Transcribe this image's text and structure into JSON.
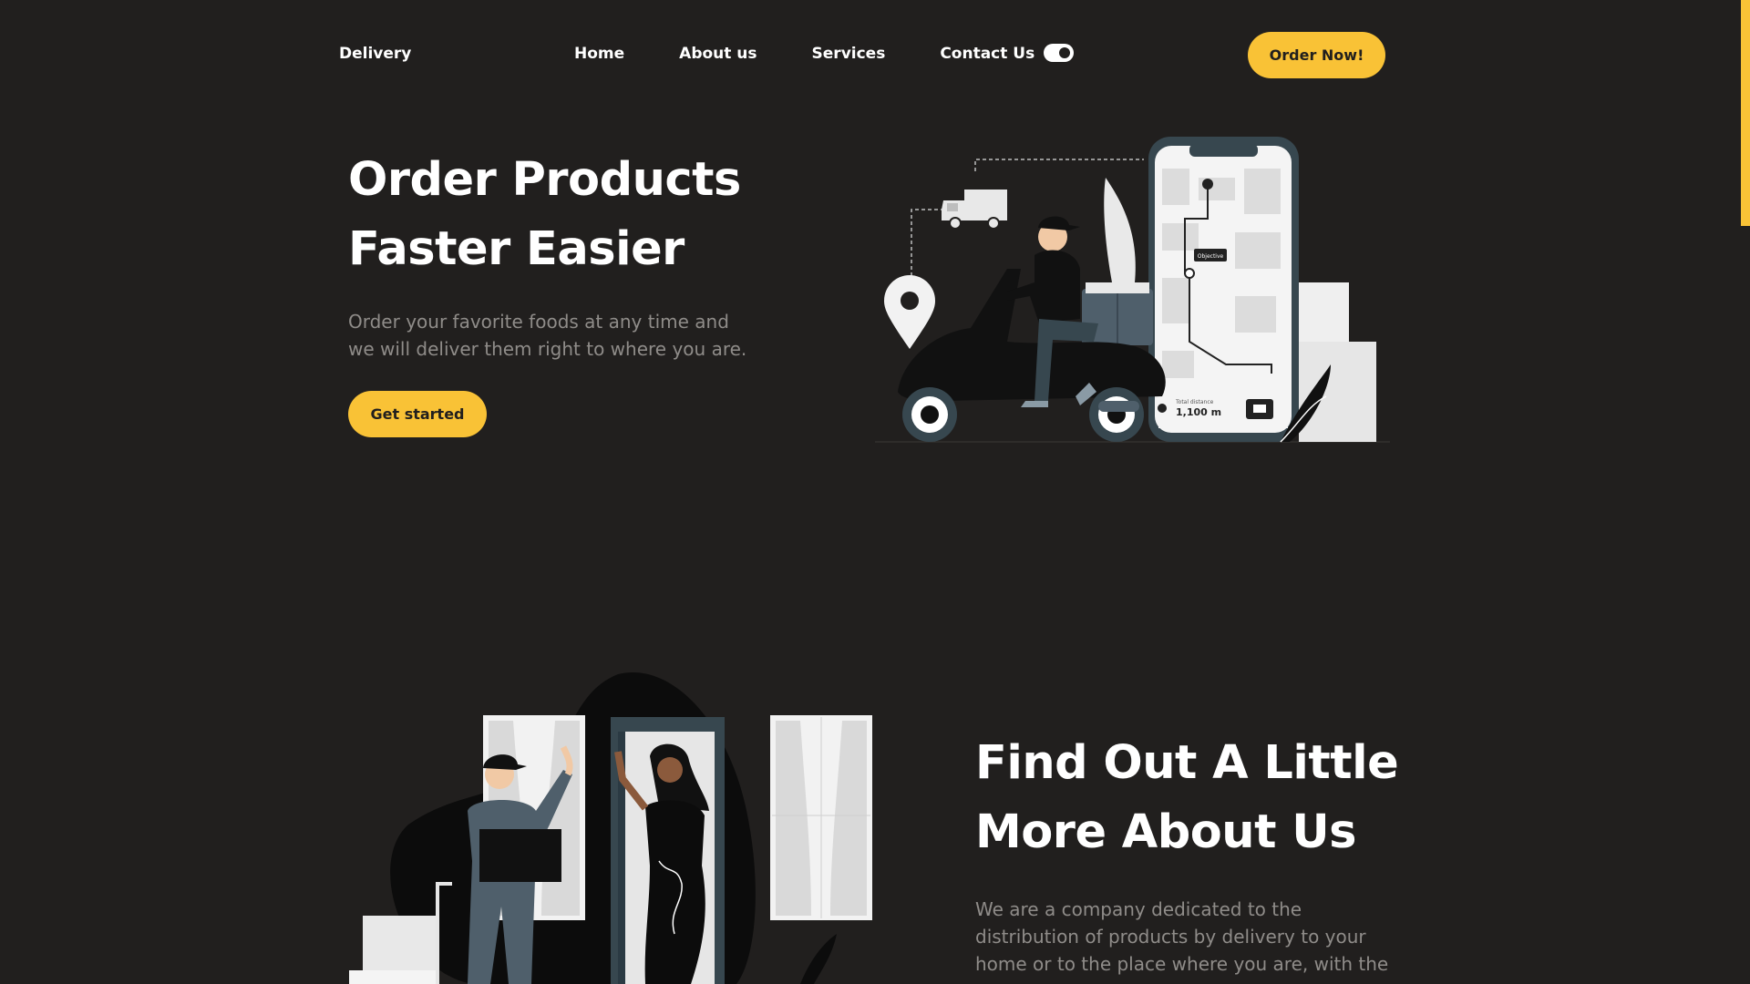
{
  "header": {
    "logo": "Delivery",
    "nav": [
      "Home",
      "About us",
      "Services",
      "Contact Us"
    ],
    "theme_toggle_state": "dark",
    "order_button": "Order Now!"
  },
  "hero": {
    "title_line1": "Order Products",
    "title_line2": "Faster Easier",
    "description": "Order your favorite foods at any time and we will deliver them right to where you are.",
    "cta_label": "Get started",
    "illustration": {
      "map_label": "Objective",
      "distance_caption": "Total distance",
      "distance_value": "1,100 m"
    }
  },
  "about": {
    "title_line1": "Find Out A Little",
    "title_line2": "More About Us",
    "description": "We are a company dedicated to the distribution of products by delivery to your home or to the place where you are, with the"
  },
  "colors": {
    "background": "#211f1e",
    "accent": "#f9c236",
    "text": "#ffffff",
    "muted_text": "#8f8c89"
  }
}
